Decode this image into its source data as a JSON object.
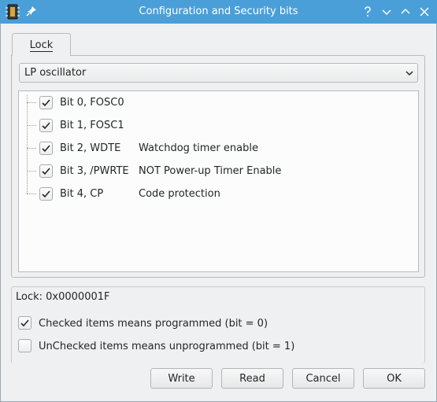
{
  "window": {
    "title": "Configuration and Security bits",
    "colors": {
      "titlebar": "#4a9fd9",
      "check": "#232627"
    }
  },
  "tabs": [
    {
      "label": "Lock"
    }
  ],
  "oscillator": {
    "selected": "LP oscillator"
  },
  "bits": [
    {
      "name": "Bit 0, FOSC0",
      "description": "",
      "checked": true
    },
    {
      "name": "Bit 1, FOSC1",
      "description": "",
      "checked": true
    },
    {
      "name": "Bit 2, WDTE",
      "description": "Watchdog timer enable",
      "checked": true
    },
    {
      "name": "Bit 3, /PWRTE",
      "description": "NOT Power-up Timer Enable",
      "checked": true
    },
    {
      "name": "Bit 4, CP",
      "description": "Code protection",
      "checked": true
    }
  ],
  "lock_value": "Lock: 0x0000001F",
  "legend": [
    {
      "text": "Checked items means programmed (bit = 0)",
      "checked": true
    },
    {
      "text": "UnChecked items means unprogrammed (bit = 1)",
      "checked": false
    }
  ],
  "buttons": {
    "write": "Write",
    "read": "Read",
    "cancel": "Cancel",
    "ok": "OK"
  },
  "icons": [
    "app-icon",
    "pin-icon",
    "help-icon",
    "minimize-icon",
    "maximize-icon",
    "close-icon",
    "chevron-down-icon",
    "checkmark-icon"
  ]
}
